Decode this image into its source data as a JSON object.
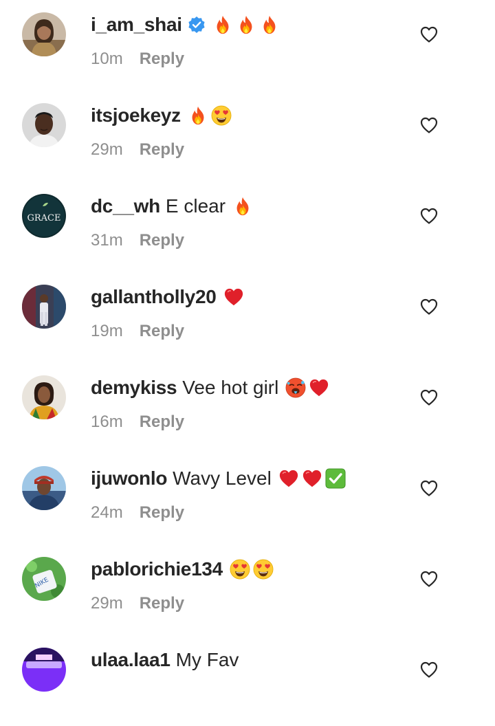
{
  "reply_label": "Reply",
  "colors": {
    "username": "#262626",
    "meta": "#8e8e8e",
    "verified": "#3897f0",
    "background": "#ffffff"
  },
  "comments": [
    {
      "username": "i_am_shai",
      "verified": true,
      "text": "",
      "emojis": [
        "fire",
        "fire",
        "fire"
      ],
      "time": "10m"
    },
    {
      "username": "itsjoekeyz",
      "verified": false,
      "text": "",
      "emojis": [
        "fire",
        "heart-eyes"
      ],
      "time": "29m"
    },
    {
      "username": "dc__wh",
      "verified": false,
      "text": "E clear",
      "emojis": [
        "fire"
      ],
      "time": "31m"
    },
    {
      "username": "gallantholly20",
      "verified": false,
      "text": "",
      "emojis": [
        "red-heart"
      ],
      "time": "19m"
    },
    {
      "username": "demykiss",
      "verified": false,
      "text": "Vee hot girl",
      "emojis": [
        "hot-face",
        "red-heart"
      ],
      "time": "16m"
    },
    {
      "username": "ijuwonlo",
      "verified": false,
      "text": "Wavy Level",
      "emojis": [
        "red-heart",
        "red-heart",
        "check-mark"
      ],
      "time": "24m"
    },
    {
      "username": "pablorichie134",
      "verified": false,
      "text": "",
      "emojis": [
        "heart-eyes",
        "heart-eyes"
      ],
      "time": "29m"
    },
    {
      "username": "ulaa.laa1",
      "verified": false,
      "text": "My Fav",
      "emojis": [],
      "time": ""
    }
  ],
  "avatar_texts": {
    "dc__wh": "GRACE"
  }
}
